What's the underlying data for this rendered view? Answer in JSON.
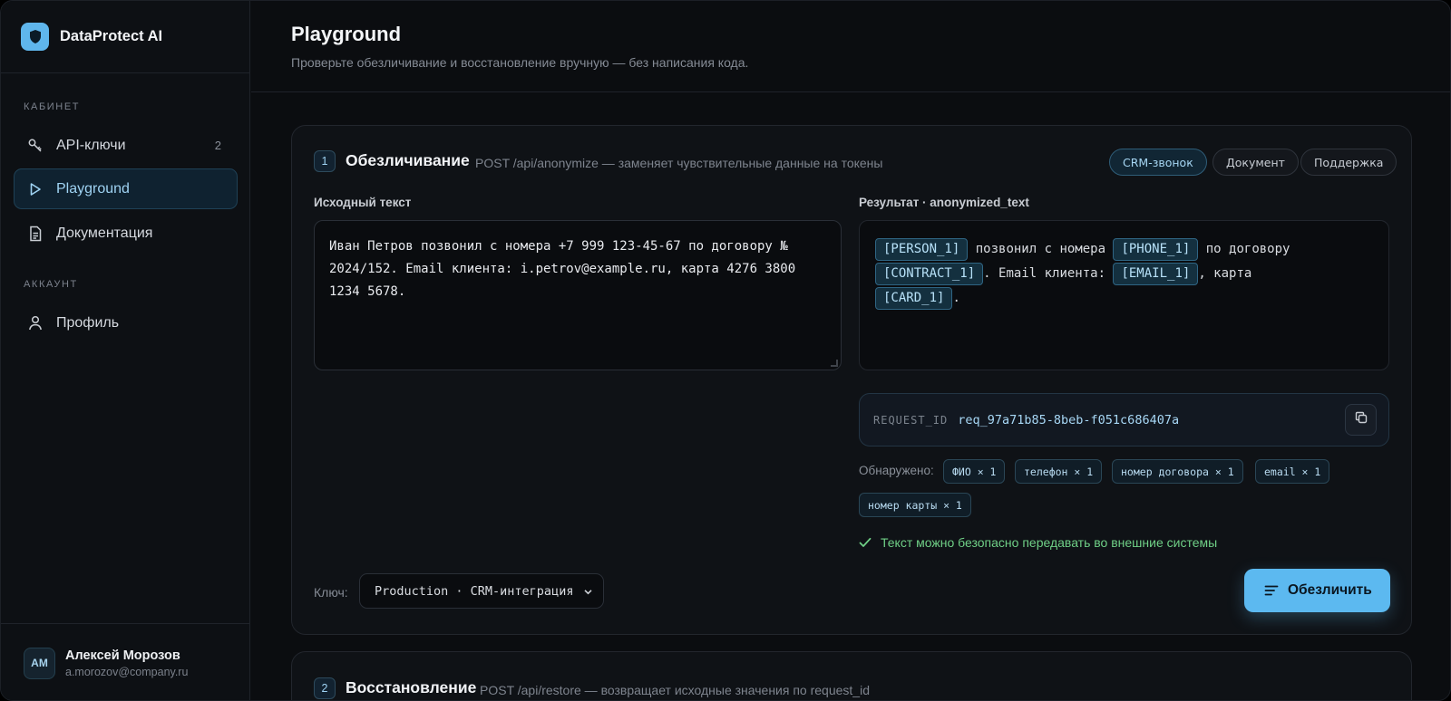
{
  "app": {
    "name": "DataProtect AI"
  },
  "sidebar": {
    "section_cabinet": "КАБИНЕТ",
    "section_account": "АККАУНТ",
    "items": [
      {
        "label": "API-ключи",
        "count": "2",
        "icon": "key-icon"
      },
      {
        "label": "Playground",
        "icon": "play-icon",
        "active": true
      },
      {
        "label": "Документация",
        "icon": "document-icon"
      },
      {
        "label": "Профиль",
        "icon": "user-icon"
      }
    ],
    "user": {
      "initials": "АМ",
      "name": "Алексей Морозов",
      "email": "a.morozov@company.ru"
    }
  },
  "header": {
    "title": "Playground",
    "subtitle": "Проверьте обезличивание и восстановление вручную — без написания кода."
  },
  "anonymize": {
    "step": "1",
    "title": "Обезличивание",
    "desc": "POST /api/anonymize — заменяет чувствительные данные на токены",
    "presets": [
      "CRM-звонок",
      "Документ",
      "Поддержка"
    ],
    "input_label": "Исходный текст",
    "input_value": "Иван Петров позвонил с номера +7 999 123-45-67 по договору № 2024/152. Email клиента: i.petrov@example.ru, карта 4276 3800 1234 5678.",
    "result_label": "Результат · anonymized_text",
    "result": {
      "t1": "[PERSON_1]",
      "s1": " позвонил с номера ",
      "t2": "[PHONE_1]",
      "s2": " по договору ",
      "t3": "[CONTRACT_1]",
      "s3": ". Email клиента: ",
      "t4": "[EMAIL_1]",
      "s4": ", карта ",
      "t5": "[CARD_1]",
      "s5": "."
    },
    "request_label": "REQUEST_ID",
    "request_id": "req_97a71b85-8beb-f051c686407a",
    "detected_label": "Обнаружено:",
    "detected": [
      "ФИО × 1",
      "телефон × 1",
      "номер договора × 1",
      "email × 1",
      "номер карты × 1"
    ],
    "safe_message": "Текст можно безопасно передавать во внешние системы",
    "key_label": "Ключ:",
    "key_value": "Production · CRM-интеграция",
    "submit_label": "Обезличить"
  },
  "restore": {
    "step": "2",
    "title": "Восстановление",
    "desc": "POST /api/restore — возвращает исходные значения по request_id"
  },
  "colors": {
    "accent": "#5cb9f0",
    "success": "#6fcf86",
    "background": "#0b0d10"
  }
}
